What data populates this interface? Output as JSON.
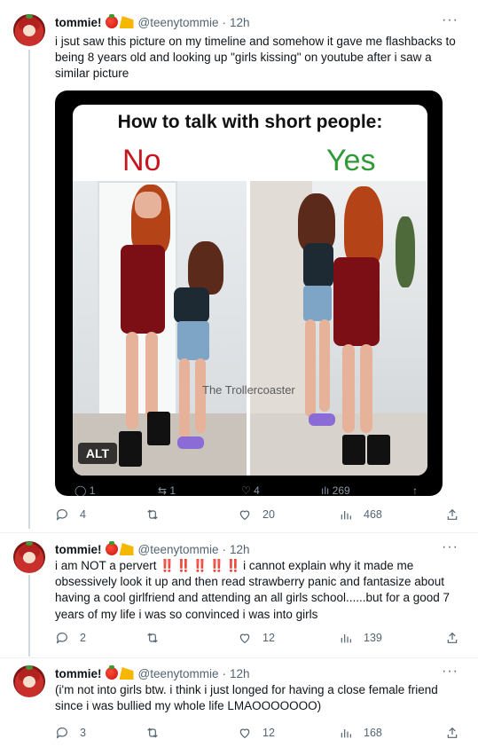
{
  "tweets": [
    {
      "name": "tommie!",
      "handle": "@teenytommie",
      "time": "12h",
      "text": "i jsut saw this picture on my timeline and somehow it gave me flashbacks to being 8 years old and looking up \"girls kissing\" on youtube after i saw a similar picture",
      "replies": "4",
      "retweets": "",
      "likes": "20",
      "views": "468"
    },
    {
      "name": "tommie!",
      "handle": "@teenytommie",
      "time": "12h",
      "text_before": "i am NOT a pervert",
      "bangs": "‼️ ‼️ ‼️ ‼️ ‼️",
      "text_after": " i cannot explain why it made me obsessively look it up and then read strawberry panic and fantasize about having a cool girlfriend and attending an all girls school......but for a good 7 years of my life i was so convinced i was into girls",
      "replies": "2",
      "retweets": "",
      "likes": "12",
      "views": "139"
    },
    {
      "name": "tommie!",
      "handle": "@teenytommie",
      "time": "12h",
      "text": "(i'm not into girls btw. i think i just longed for having a close female friend since i was bullied my whole life LMAOOOOOOO)",
      "replies": "3",
      "retweets": "",
      "likes": "12",
      "views": "168"
    }
  ],
  "media": {
    "title": "How to talk with short people:",
    "label_no": "No",
    "label_yes": "Yes",
    "watermark": "The Trollercoaster",
    "alt": "ALT",
    "inner_actions": {
      "replies": "1",
      "retweets": "1",
      "likes": "4",
      "views": "269"
    }
  },
  "separator": "·",
  "icons": [
    "reply-icon",
    "retweet-icon",
    "like-icon",
    "views-icon",
    "share-icon",
    "more-icon"
  ]
}
